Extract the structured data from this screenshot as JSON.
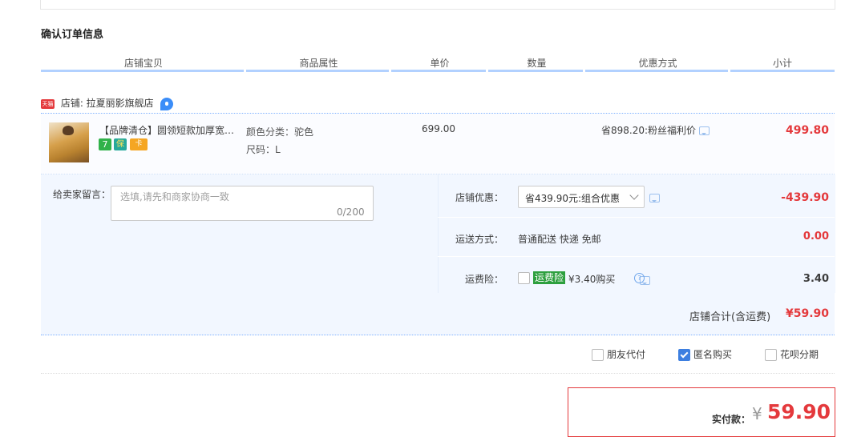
{
  "section_title": "确认订单信息",
  "columns": [
    "店铺宝贝",
    "商品属性",
    "单价",
    "数量",
    "优惠方式",
    "小计"
  ],
  "shop": {
    "tmall_badge": "天猫",
    "label": "店铺: 拉夏丽影旗舰店",
    "chat_icon": "wangwang-chat-icon"
  },
  "item": {
    "title": "【品牌清仓】圆领短款加厚宽松毛衣",
    "badges": [
      "7",
      "保",
      "卡"
    ],
    "color_prop": "颜色分类：驼色",
    "size_prop": "尺码：L",
    "unit_price": "699.00",
    "discount": "省898.20:粉丝福利价",
    "subtotal": "499.80"
  },
  "message": {
    "label": "给卖家留言：",
    "placeholder": "选填,请先和商家协商一致",
    "count": "0/200"
  },
  "shop_discount": {
    "label": "店铺优惠：",
    "selected": "省439.90元:组合优惠",
    "amount": "-439.90"
  },
  "shipping": {
    "label": "运送方式：",
    "value": "普通配送 快递 免邮",
    "amount": "0.00"
  },
  "insurance": {
    "label": "运费险：",
    "tag": "运费险",
    "text": "¥3.40购买",
    "amount": "3.40"
  },
  "shop_total": {
    "label": "店铺合计(含运费)",
    "amount": "¥59.90"
  },
  "options": [
    {
      "label": "朋友代付",
      "checked": false
    },
    {
      "label": "匿名购买",
      "checked": true
    },
    {
      "label": "花呗分期",
      "checked": false
    }
  ],
  "payment": {
    "label": "实付款：",
    "currency": "¥",
    "amount": "59.90"
  },
  "colors": {
    "accent_red": "#e4393c",
    "header_underline": "#b2d1ff",
    "panel_bg": "#f2f7ff",
    "checkbox_blue": "#3d7fe0"
  }
}
